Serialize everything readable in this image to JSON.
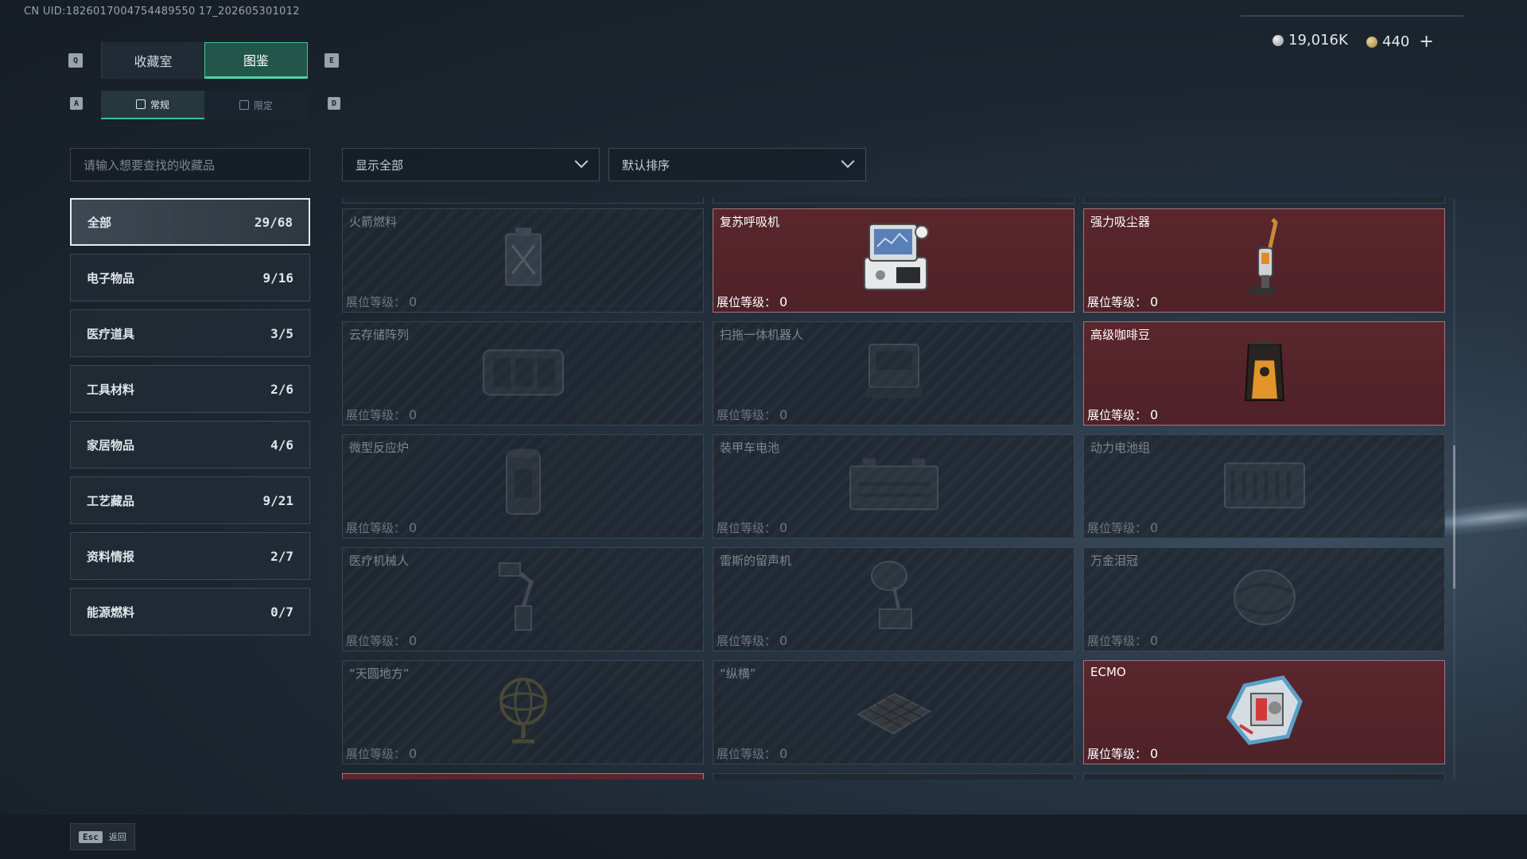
{
  "uid": "CN UID:1826017004754489550 17_202605301012",
  "currency": {
    "silver": "19,016K",
    "gold": "440",
    "plus": "+"
  },
  "keys": {
    "q": "Q",
    "e": "E",
    "a": "A",
    "d": "D"
  },
  "main_tabs": [
    {
      "label": "收藏室"
    },
    {
      "label": "图鉴"
    }
  ],
  "sub_tabs": [
    {
      "label": "常规"
    },
    {
      "label": "限定"
    }
  ],
  "search": {
    "placeholder": "请输入想要查找的收藏品"
  },
  "filters": {
    "show": "显示全部",
    "sort": "默认排序"
  },
  "categories": [
    {
      "label": "全部",
      "count": "29/68"
    },
    {
      "label": "电子物品",
      "count": "9/16"
    },
    {
      "label": "医疗道具",
      "count": "3/5"
    },
    {
      "label": "工具材料",
      "count": "2/6"
    },
    {
      "label": "家居物品",
      "count": "4/6"
    },
    {
      "label": "工艺藏品",
      "count": "9/21"
    },
    {
      "label": "资料情报",
      "count": "2/7"
    },
    {
      "label": "能源燃料",
      "count": "0/7"
    }
  ],
  "level_label": "展位等级：",
  "items": [
    {
      "name": "火箭燃料",
      "level": "0",
      "owned": false,
      "icon": "fuel-can-icon"
    },
    {
      "name": "复苏呼吸机",
      "level": "0",
      "owned": true,
      "icon": "ventilator-icon"
    },
    {
      "name": "强力吸尘器",
      "level": "0",
      "owned": true,
      "icon": "vacuum-icon"
    },
    {
      "name": "云存储阵列",
      "level": "0",
      "owned": false,
      "icon": "storage-array-icon"
    },
    {
      "name": "扫拖一体机器人",
      "level": "0",
      "owned": false,
      "icon": "robot-cleaner-icon"
    },
    {
      "name": "高级咖啡豆",
      "level": "0",
      "owned": true,
      "icon": "coffee-bag-icon"
    },
    {
      "name": "微型反应炉",
      "level": "0",
      "owned": false,
      "icon": "reactor-icon"
    },
    {
      "name": "装甲车电池",
      "level": "0",
      "owned": false,
      "icon": "battery-icon"
    },
    {
      "name": "动力电池组",
      "level": "0",
      "owned": false,
      "icon": "battery-pack-icon"
    },
    {
      "name": "医疗机械人",
      "level": "0",
      "owned": false,
      "icon": "medical-robot-icon"
    },
    {
      "name": "雷斯的留声机",
      "level": "0",
      "owned": false,
      "icon": "gramophone-icon"
    },
    {
      "name": "万金泪冠",
      "level": "0",
      "owned": false,
      "icon": "crown-icon"
    },
    {
      "name": "“天圆地方”",
      "level": "0",
      "owned": false,
      "icon": "armillary-icon"
    },
    {
      "name": "“纵横”",
      "level": "0",
      "owned": false,
      "icon": "chessboard-icon"
    },
    {
      "name": "ECMO",
      "level": "0",
      "owned": true,
      "icon": "ecmo-icon"
    }
  ],
  "footer": {
    "esc": "Esc",
    "back": "返回"
  }
}
